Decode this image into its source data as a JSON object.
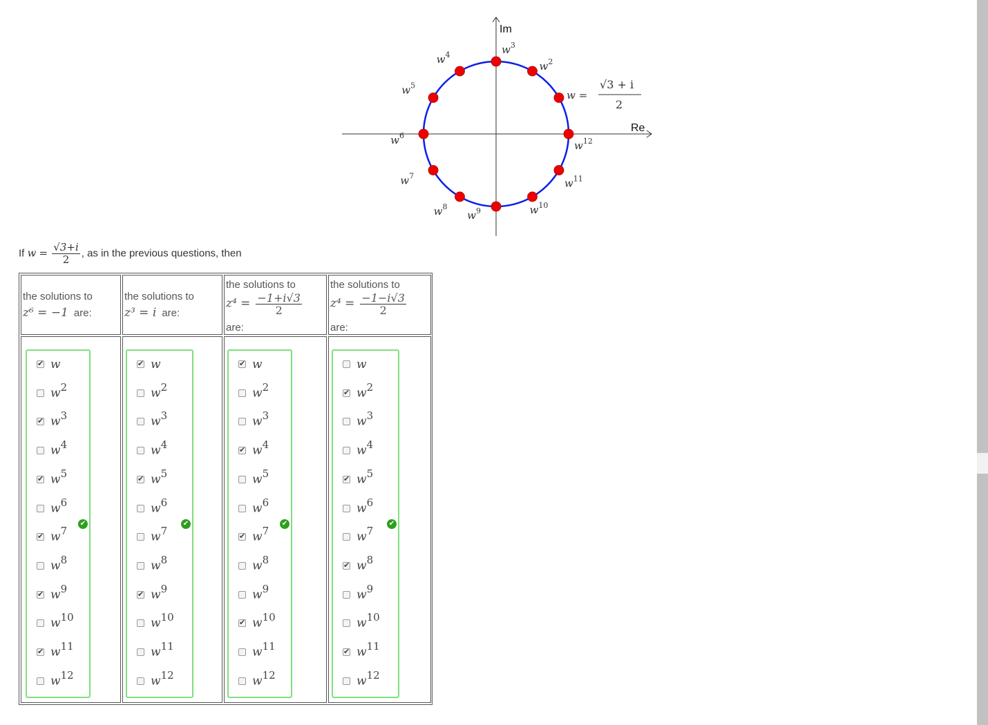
{
  "diagram": {
    "axis_im": "Im",
    "axis_re": "Re",
    "w_label": "w =",
    "w_frac_num": "√3 + i",
    "w_frac_den": "2",
    "root_labels": [
      "w",
      "w2",
      "w3",
      "w4",
      "w5",
      "w6",
      "w7",
      "w8",
      "w9",
      "w10",
      "w11",
      "w12"
    ],
    "circle_color": "#0a1ee8",
    "point_color": "#ee0000"
  },
  "intro": {
    "prefix": "If",
    "var": "w",
    "eq": "=",
    "frac_num": "√3+i",
    "frac_den": "2",
    "suffix": ", as in the previous questions, then"
  },
  "columns": [
    {
      "header_line1": "the solutions to",
      "header_eq": "z⁶ = −1",
      "header_tail": "are:",
      "checked": [
        true,
        false,
        true,
        false,
        true,
        false,
        true,
        false,
        true,
        false,
        true,
        false
      ],
      "correct": true
    },
    {
      "header_line1": "the solutions to",
      "header_eq": "z³ = i",
      "header_tail": "are:",
      "checked": [
        true,
        false,
        false,
        false,
        true,
        false,
        false,
        false,
        true,
        false,
        false,
        false
      ],
      "correct": true
    },
    {
      "header_line1": "the solutions to",
      "header_eq": "z⁴ =",
      "header_frac_num": "−1+i√3",
      "header_frac_den": "2",
      "header_tail": "are:",
      "checked": [
        true,
        false,
        false,
        true,
        false,
        false,
        true,
        false,
        false,
        true,
        false,
        false
      ],
      "correct": true
    },
    {
      "header_line1": "the solutions to",
      "header_eq": "z⁴ =",
      "header_frac_num": "−1−i√3",
      "header_frac_den": "2",
      "header_tail": "are:",
      "checked": [
        false,
        true,
        false,
        false,
        true,
        false,
        false,
        true,
        false,
        false,
        true,
        false
      ],
      "correct": true
    }
  ],
  "option_labels": [
    "w",
    "w2",
    "w3",
    "w4",
    "w5",
    "w6",
    "w7",
    "w8",
    "w9",
    "w10",
    "w11",
    "w12"
  ],
  "colors": {
    "correct_border": "#7ee07e",
    "correct_icon": "#2e9e1f"
  }
}
